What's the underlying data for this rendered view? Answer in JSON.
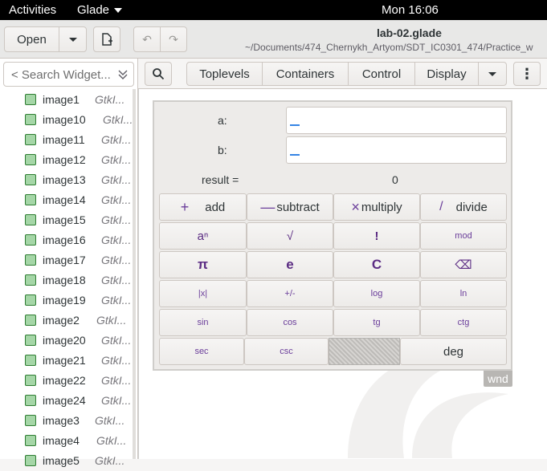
{
  "topbar": {
    "activities": "Activities",
    "app": "Glade",
    "clock": "Mon 16:06"
  },
  "header": {
    "open": "Open",
    "title": "lab-02.glade",
    "subtitle": "~/Documents/474_Chernykh_Artyom/SDT_IC0301_474/Practice_w"
  },
  "search": {
    "placeholder": "< Search Widget..."
  },
  "widgets": [
    {
      "name": "image1",
      "type": "GtkI..."
    },
    {
      "name": "image10",
      "type": "GtkI..."
    },
    {
      "name": "image11",
      "type": "GtkI..."
    },
    {
      "name": "image12",
      "type": "GtkI..."
    },
    {
      "name": "image13",
      "type": "GtkI..."
    },
    {
      "name": "image14",
      "type": "GtkI..."
    },
    {
      "name": "image15",
      "type": "GtkI..."
    },
    {
      "name": "image16",
      "type": "GtkI..."
    },
    {
      "name": "image17",
      "type": "GtkI..."
    },
    {
      "name": "image18",
      "type": "GtkI..."
    },
    {
      "name": "image19",
      "type": "GtkI..."
    },
    {
      "name": "image2",
      "type": "GtkI..."
    },
    {
      "name": "image20",
      "type": "GtkI..."
    },
    {
      "name": "image21",
      "type": "GtkI..."
    },
    {
      "name": "image22",
      "type": "GtkI..."
    },
    {
      "name": "image24",
      "type": "GtkI..."
    },
    {
      "name": "image3",
      "type": "GtkI..."
    },
    {
      "name": "image4",
      "type": "GtkI..."
    },
    {
      "name": "image5",
      "type": "GtkI..."
    }
  ],
  "palette": {
    "toplevels": "Toplevels",
    "containers": "Containers",
    "control": "Control",
    "display": "Display"
  },
  "calc": {
    "a_label": "a:",
    "b_label": "b:",
    "result_label": "result =",
    "result_value": "0",
    "add": "add",
    "subtract": "subtract",
    "multiply": "multiply",
    "divide": "divide",
    "pow": "aⁿ",
    "root": "√",
    "fact": "!",
    "mod": "mod",
    "pi": "π",
    "e": "e",
    "clear": "C",
    "back": "⌫",
    "abs": "|x|",
    "sign": "+/-",
    "log": "log",
    "ln": "ln",
    "sin": "sin",
    "cos": "cos",
    "tg": "tg",
    "ctg": "ctg",
    "sec": "sec",
    "csc": "csc",
    "deg": "deg"
  },
  "wnd_tag": "wnd"
}
